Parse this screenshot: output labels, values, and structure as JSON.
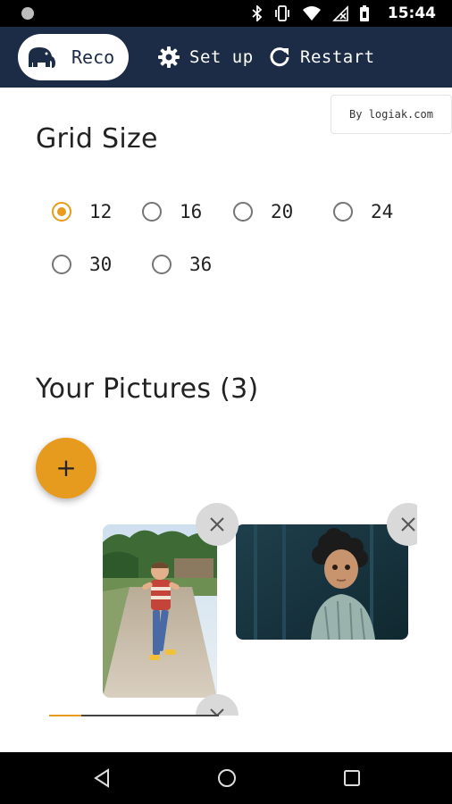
{
  "status_bar": {
    "time": "15:44",
    "icons": [
      "bluetooth-icon",
      "vibrate-icon",
      "wifi-icon",
      "no-signal-icon",
      "battery-icon"
    ]
  },
  "header": {
    "brand_text": "Reco",
    "setup_label": "Set up",
    "restart_label": "Restart"
  },
  "badge": {
    "text": "By logiak.com"
  },
  "grid_size": {
    "title": "Grid Size",
    "options": [
      "12",
      "16",
      "20",
      "24",
      "30",
      "36"
    ],
    "selected": "12"
  },
  "pictures": {
    "title": "Your Pictures (3)",
    "add_label": "+",
    "count": 3
  },
  "colors": {
    "header_bg": "#1c2b46",
    "accent": "#e79b1e"
  }
}
